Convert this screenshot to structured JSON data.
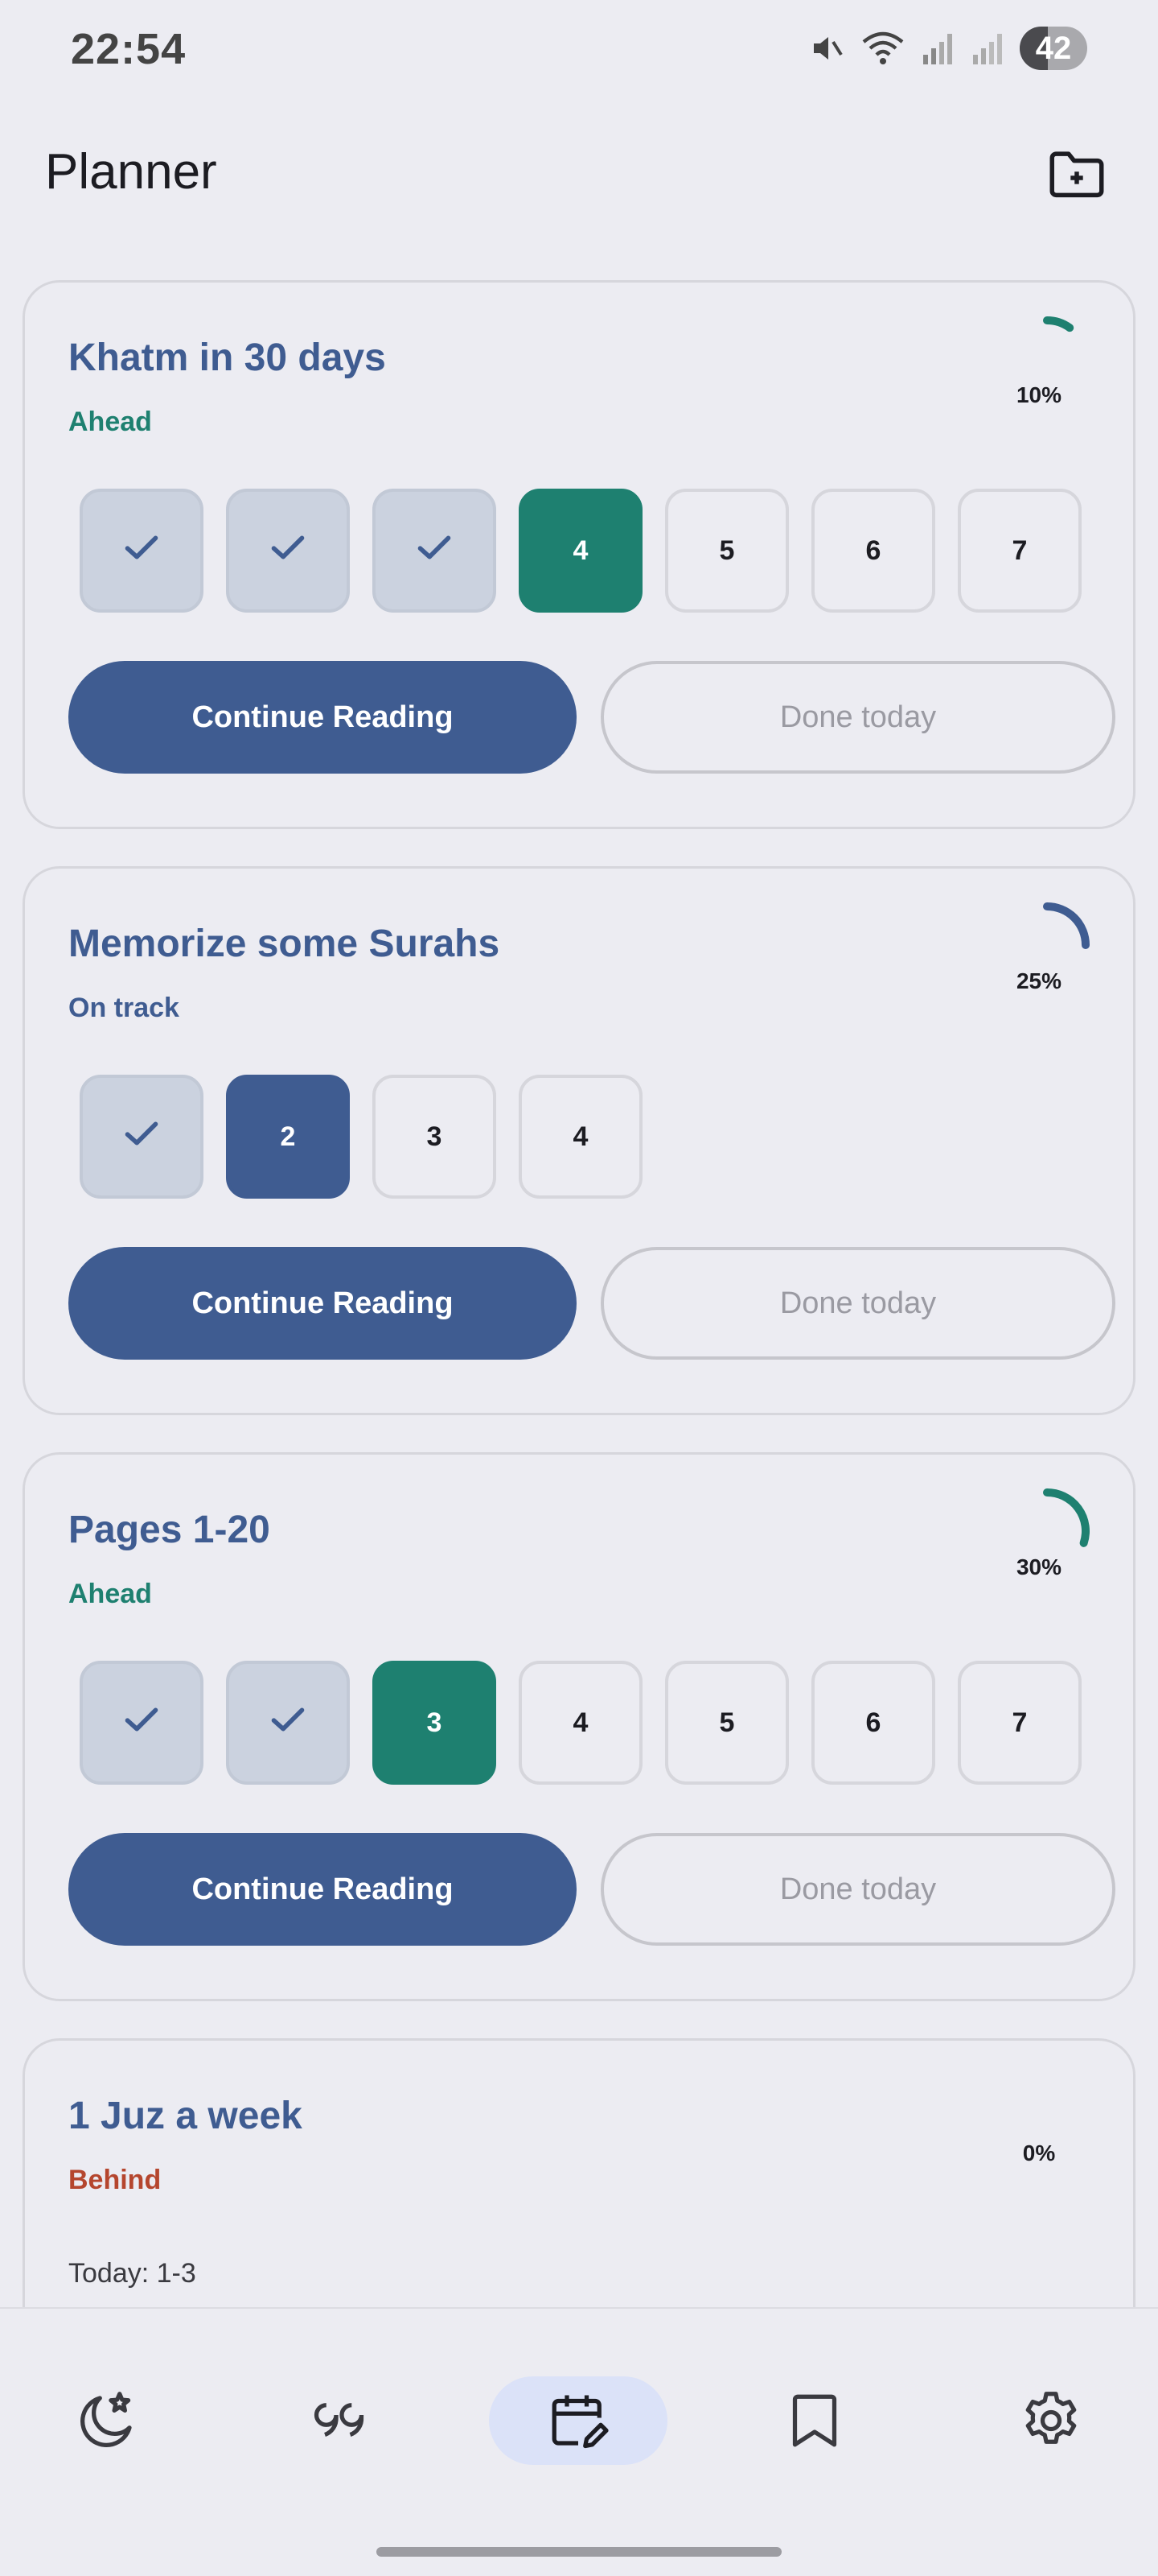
{
  "status_bar": {
    "time": "22:54",
    "battery": "42",
    "battery_level": 0.42,
    "icons": [
      "mute-icon",
      "wifi-icon",
      "signal-icon",
      "signal-icon",
      "battery-icon"
    ]
  },
  "header": {
    "title": "Planner",
    "action_icon": "folder-plus-icon"
  },
  "colors": {
    "primary": "#3F5C91",
    "ahead": "#1E8070",
    "on_track": "#3F5C91",
    "behind": "#B5462E"
  },
  "plans": [
    {
      "title": "Khatm in 30 days",
      "status": "Ahead",
      "status_color": "#1E8070",
      "progress_label": "10%",
      "progress": 0.1,
      "progress_color": "#1E8070",
      "days": [
        {
          "label": "",
          "state": "done"
        },
        {
          "label": "",
          "state": "done"
        },
        {
          "label": "",
          "state": "done"
        },
        {
          "label": "4",
          "state": "current"
        },
        {
          "label": "5",
          "state": "upcoming"
        },
        {
          "label": "6",
          "state": "upcoming"
        },
        {
          "label": "7",
          "state": "upcoming"
        }
      ],
      "primary_action": "Continue Reading",
      "secondary_action": "Done today"
    },
    {
      "title": "Memorize some Surahs",
      "status": "On track",
      "status_color": "#3F5C91",
      "progress_label": "25%",
      "progress": 0.25,
      "progress_color": "#3F5C91",
      "days": [
        {
          "label": "",
          "state": "done"
        },
        {
          "label": "2",
          "state": "current"
        },
        {
          "label": "3",
          "state": "upcoming"
        },
        {
          "label": "4",
          "state": "upcoming"
        }
      ],
      "primary_action": "Continue Reading",
      "secondary_action": "Done today"
    },
    {
      "title": "Pages 1-20",
      "status": "Ahead",
      "status_color": "#1E8070",
      "progress_label": "30%",
      "progress": 0.3,
      "progress_color": "#1E8070",
      "days": [
        {
          "label": "",
          "state": "done"
        },
        {
          "label": "",
          "state": "done"
        },
        {
          "label": "3",
          "state": "current"
        },
        {
          "label": "4",
          "state": "upcoming"
        },
        {
          "label": "5",
          "state": "upcoming"
        },
        {
          "label": "6",
          "state": "upcoming"
        },
        {
          "label": "7",
          "state": "upcoming"
        }
      ],
      "primary_action": "Continue Reading",
      "secondary_action": "Done today"
    },
    {
      "title": "1 Juz a week",
      "status": "Behind",
      "status_color": "#B5462E",
      "progress_label": "0%",
      "progress": 0,
      "progress_color": "#1E8070",
      "today": "Today: 1-3"
    }
  ],
  "bottom_nav": {
    "items": [
      {
        "icon": "moon-star-icon",
        "active": false
      },
      {
        "icon": "quote-icon",
        "active": false
      },
      {
        "icon": "calendar-edit-icon",
        "active": true
      },
      {
        "icon": "bookmark-icon",
        "active": false
      },
      {
        "icon": "settings-icon",
        "active": false
      }
    ]
  }
}
